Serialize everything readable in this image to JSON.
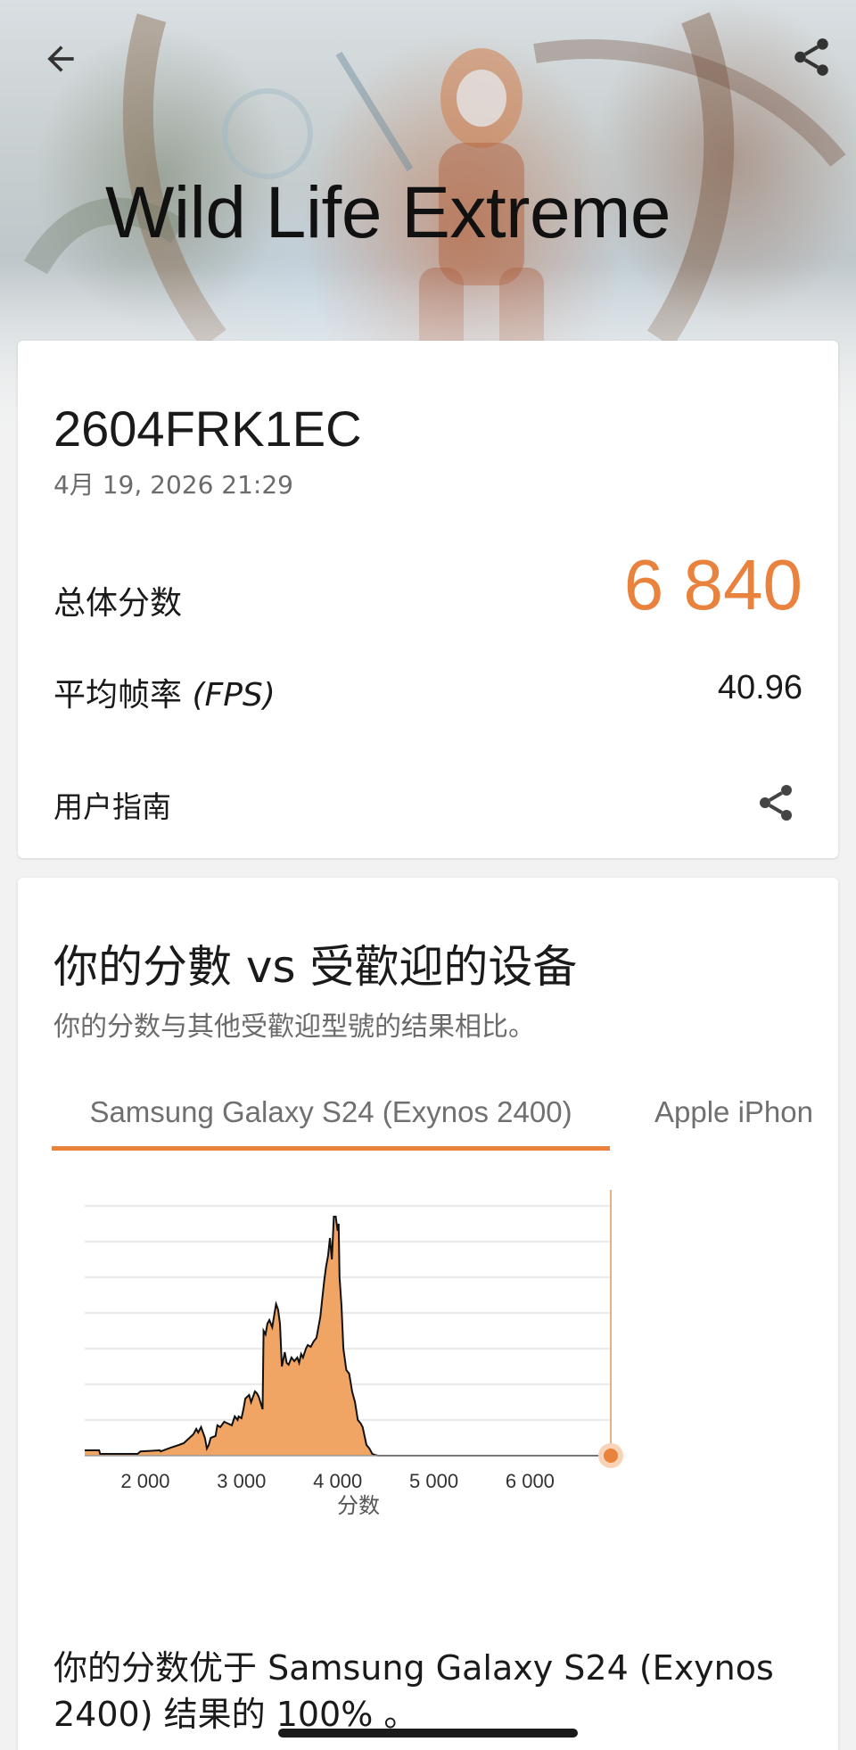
{
  "header": {
    "title": "Wild Life Extreme",
    "back_icon": "arrow-left-icon",
    "share_icon": "share-icon"
  },
  "result": {
    "device": "2604FRK1EC",
    "datetime": "4月 19, 2026 21:29",
    "overall_label": "总体分数",
    "overall_score": "6 840",
    "fps_label": "平均帧率",
    "fps_unit": "(FPS)",
    "fps_value": "40.96",
    "guide_label": "用户指南",
    "accent_color": "#e8823c"
  },
  "compare": {
    "title": "你的分數 vs 受歡迎的设备",
    "subtitle": "你的分数与其他受歡迎型號的结果相比。",
    "tabs": [
      {
        "label": "Samsung Galaxy S24 (Exynos 2400)",
        "active": true
      },
      {
        "label": "Apple iPhon",
        "active": false
      }
    ],
    "sentence_line1": "你的分数优于 Samsung Galaxy S24 (Exynos",
    "sentence_line2": "2400) 结果的 100% 。"
  },
  "chart_data": {
    "type": "area",
    "xlabel": "分数",
    "x_ticks": [
      2000,
      3000,
      4000,
      5000,
      6000
    ],
    "x_tick_labels": [
      "2 000",
      "3 000",
      "4 000",
      "5 000",
      "6 000"
    ],
    "xlim": [
      1370,
      6840
    ],
    "ylim": [
      0,
      7
    ],
    "grid": true,
    "fill_color": "#f0a565",
    "marker": {
      "x": 6840,
      "color": "#e8823c"
    },
    "x": [
      1370,
      1520,
      1530,
      1920,
      1950,
      2150,
      2160,
      2260,
      2350,
      2400,
      2500,
      2530,
      2550,
      2580,
      2620,
      2640,
      2660,
      2680,
      2730,
      2750,
      2780,
      2820,
      2860,
      2900,
      2930,
      2960,
      2970,
      3000,
      3020,
      3040,
      3080,
      3100,
      3140,
      3160,
      3180,
      3220,
      3230,
      3250,
      3270,
      3290,
      3320,
      3360,
      3380,
      3400,
      3420,
      3450,
      3470,
      3490,
      3520,
      3550,
      3580,
      3600,
      3620,
      3640,
      3670,
      3690,
      3720,
      3750,
      3780,
      3800,
      3820,
      3840,
      3860,
      3880,
      3900,
      3920,
      3940,
      3960,
      3980,
      4000,
      4010,
      4020,
      4040,
      4060,
      4090,
      4120,
      4150,
      4180,
      4210,
      4240,
      4260,
      4300,
      4330,
      4360,
      4390,
      4420,
      4440,
      4460,
      4480,
      4500,
      4510,
      6840
    ],
    "y": [
      0.15,
      0.15,
      0.05,
      0.05,
      0.12,
      0.15,
      0.12,
      0.22,
      0.3,
      0.35,
      0.6,
      0.75,
      0.65,
      0.8,
      0.5,
      0.2,
      0.3,
      0.5,
      0.55,
      0.85,
      0.8,
      0.95,
      0.9,
      0.85,
      1.1,
      1.0,
      1.1,
      1.05,
      1.3,
      1.6,
      1.7,
      1.5,
      1.8,
      1.75,
      1.65,
      1.3,
      3.5,
      3.4,
      3.7,
      3.8,
      3.6,
      4.25,
      4.1,
      3.7,
      2.5,
      2.9,
      2.6,
      2.55,
      2.75,
      2.65,
      2.75,
      2.6,
      2.85,
      2.75,
      3.0,
      3.1,
      3.05,
      3.2,
      3.3,
      3.6,
      3.9,
      4.4,
      4.9,
      5.3,
      5.6,
      6.1,
      5.5,
      6.7,
      6.7,
      6.3,
      6.5,
      5.0,
      4.2,
      3.0,
      2.4,
      2.3,
      1.8,
      1.5,
      1.0,
      0.9,
      0.8,
      0.3,
      0.2,
      0.05,
      0.02,
      0,
      0,
      0,
      0,
      0,
      0,
      0
    ]
  }
}
